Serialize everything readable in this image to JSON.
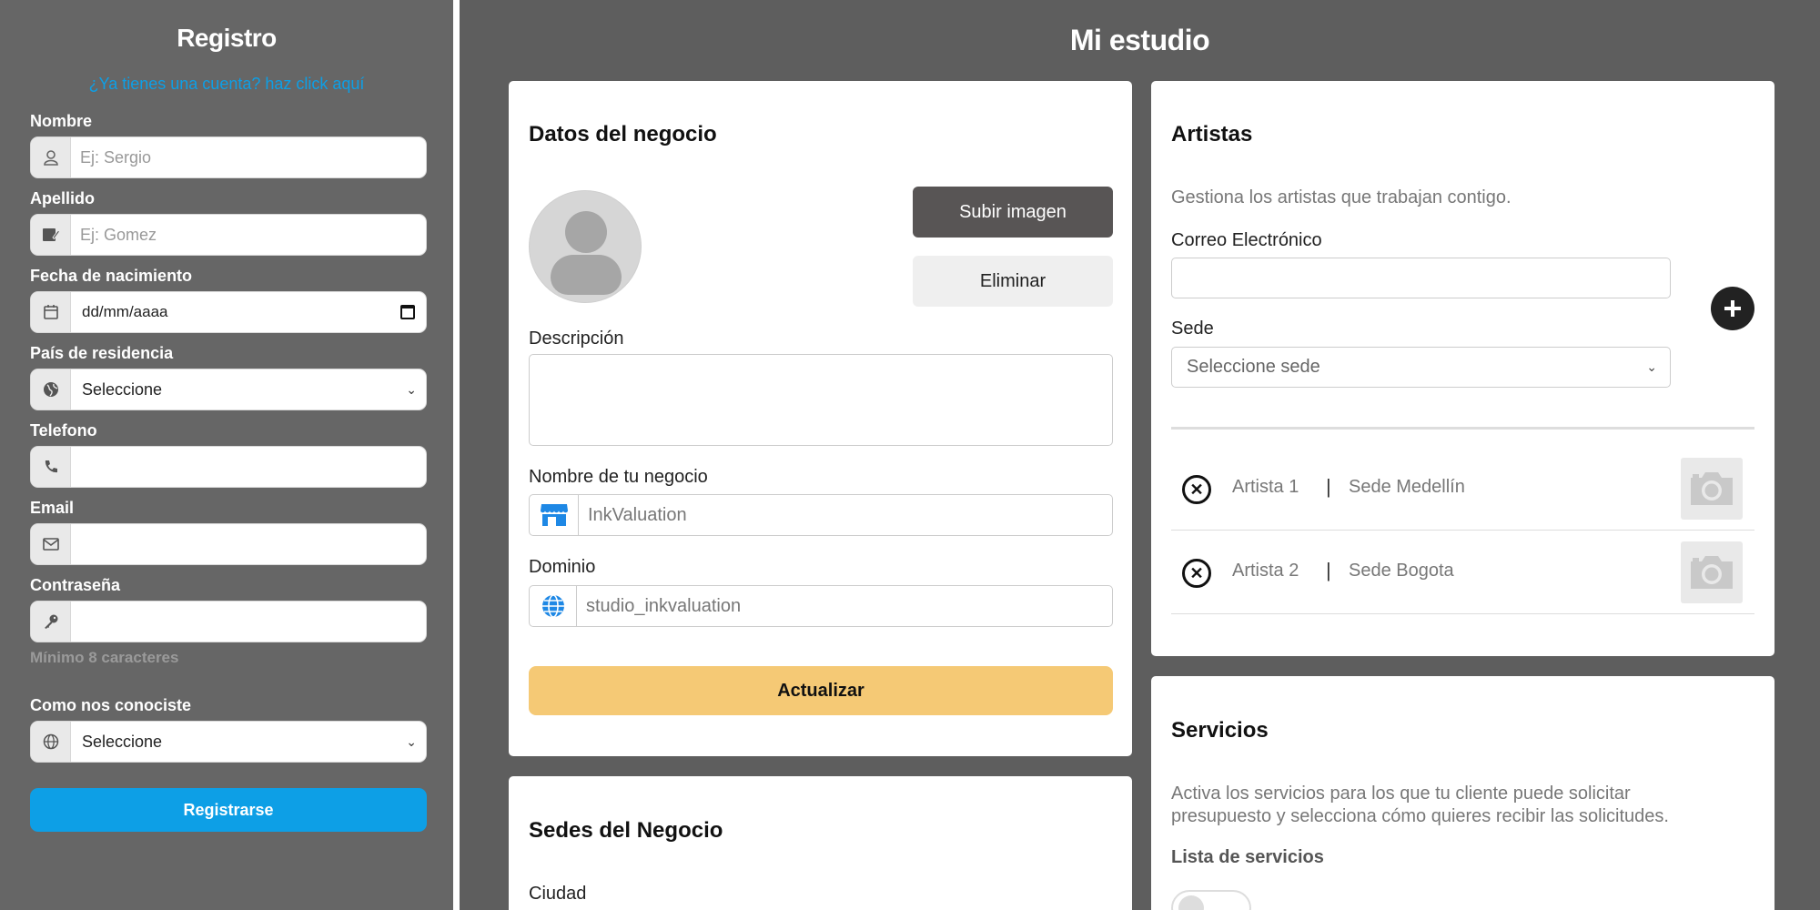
{
  "registration": {
    "title": "Registro",
    "login_link": "¿Ya tienes una cuenta? haz click aquí",
    "fields": {
      "nombre": {
        "label": "Nombre",
        "placeholder": "Ej: Sergio",
        "icon": "user-icon"
      },
      "apellido": {
        "label": "Apellido",
        "placeholder": "Ej: Gomez",
        "icon": "id-card-icon"
      },
      "fecha": {
        "label": "Fecha de nacimiento",
        "value": "dd/mm/aaaa",
        "icon": "calendar-icon"
      },
      "pais": {
        "label": "País de residencia",
        "value": "Seleccione",
        "icon": "globe-icon"
      },
      "telefono": {
        "label": "Telefono",
        "value": "",
        "icon": "phone-icon"
      },
      "email": {
        "label": "Email",
        "value": "",
        "icon": "envelope-icon"
      },
      "contrasena": {
        "label": "Contraseña",
        "value": "",
        "hint": "Mínimo 8 caracteres",
        "icon": "key-icon"
      },
      "conociste": {
        "label": "Como nos conociste",
        "value": "Seleccione",
        "icon": "globe-icon"
      }
    },
    "submit_label": "Registrarse"
  },
  "studio": {
    "title": "Mi estudio",
    "business": {
      "title": "Datos del negocio",
      "upload_label": "Subir imagen",
      "delete_label": "Eliminar",
      "description_label": "Descripción",
      "description_value": "",
      "name_label": "Nombre de tu negocio",
      "name_value": "InkValuation",
      "domain_label": "Dominio",
      "domain_value": "studio_inkvaluation",
      "update_label": "Actualizar"
    },
    "locations": {
      "title": "Sedes del Negocio",
      "city_label": "Ciudad"
    },
    "artists": {
      "title": "Artistas",
      "description": "Gestiona los artistas que trabajan contigo.",
      "email_label": "Correo Electrónico",
      "email_value": "",
      "sede_label": "Sede",
      "sede_placeholder": "Seleccione sede",
      "list": [
        {
          "name": "Artista 1",
          "separator": "|",
          "sede": "Sede Medellín"
        },
        {
          "name": "Artista 2",
          "separator": "|",
          "sede": "Sede Bogota"
        }
      ]
    },
    "services": {
      "title": "Servicios",
      "description": "Activa los servicios para los que tu cliente puede solicitar presupuesto y selecciona cómo quieres recibir las solicitudes.",
      "list_label": "Lista de servicios"
    }
  },
  "colors": {
    "primary_blue": "#0d9fe6",
    "update_yellow": "#f5c975",
    "upload_dark": "#585555",
    "background": "#666666"
  }
}
